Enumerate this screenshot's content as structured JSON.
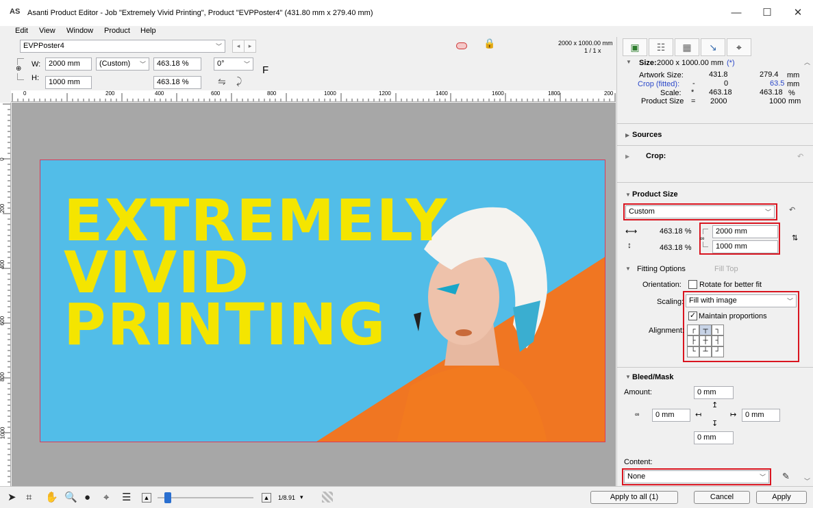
{
  "window": {
    "logo": "AS",
    "title": "Asanti Product Editor - Job \"Extremely Vivid Printing\", Product \"EVPPoster4\" (431.80 mm x 279.40 mm)",
    "minimize": "—",
    "maximize": "☐",
    "close": "✕"
  },
  "menu": [
    "Edit",
    "View",
    "Window",
    "Product",
    "Help"
  ],
  "toolbar": {
    "product_name": "EVPPoster4",
    "nav_prev": "◂",
    "nav_next": "▸",
    "lock_icon": "🔒",
    "size_readout": "2000 x 1000.00 mm",
    "page_readout": "1 / 1 x",
    "w_label": "W:",
    "h_label": "H:",
    "width_value": "2000 mm",
    "height_value": "1000 mm",
    "size_preset": "(Custom)",
    "w_percent": "463.18 %",
    "h_percent": "463.18 %",
    "rotation": "0°",
    "fit_letter": "F"
  },
  "ruler": {
    "h_labels": [
      "0",
      "200",
      "400",
      "600",
      "800",
      "1000",
      "1200",
      "1400",
      "1600",
      "1800",
      "200"
    ],
    "v_labels": [
      "0",
      "200",
      "400",
      "600",
      "800",
      "1000"
    ]
  },
  "poster": {
    "line1": "EXTREMELY",
    "line2": "VIVID",
    "line3": "PRINTING"
  },
  "panel": {
    "tabs": [
      "image-tab",
      "layout-tab",
      "grid-tab",
      "edit-tab",
      "target-tab"
    ],
    "size_label": "Size:",
    "size_value": "2000 x 1000.00 mm",
    "size_flag": "(*)",
    "artwork_size_label": "Artwork Size:",
    "artwork_w": "431.8",
    "artwork_h": "279.4",
    "artwork_unit": "mm",
    "crop_label": "Crop (fitted):",
    "crop_sep": "-",
    "crop_w": "0",
    "crop_h": "63.5",
    "crop_unit": "mm",
    "scale_label": "Scale:",
    "scale_sep": "*",
    "scale_w": "463.18",
    "scale_h": "463.18",
    "scale_unit": "%",
    "product_size_label": "Product Size",
    "product_size_eq": "=",
    "product_w": "2000",
    "product_h": "1000",
    "product_unit": "mm",
    "sources_label": "Sources",
    "crop_section": "Crop:",
    "product_size_section": "Product Size",
    "preset": "Custom",
    "pct_w": "463.18 %",
    "pct_h": "463.18 %",
    "width": "2000 mm",
    "height": "1000 mm",
    "fitting_label": "Fitting Options",
    "fitting_mode": "Fill Top",
    "orientation_label": "Orientation:",
    "rotate_label": "Rotate for better fit",
    "scaling_label": "Scaling:",
    "scaling_value": "Fill with image",
    "maintain_label": "Maintain proportions",
    "alignment_label": "Alignment:",
    "bleed_label": "Bleed/Mask",
    "amount_label": "Amount:",
    "bleed_top": "0 mm",
    "bleed_left": "0 mm",
    "bleed_right": "0 mm",
    "bleed_bottom": "0 mm",
    "content_label": "Content:",
    "content_value": "None"
  },
  "status": {
    "zoom": "1/8.91",
    "apply_all": "Apply to all (1)",
    "cancel": "Cancel",
    "apply": "Apply"
  }
}
